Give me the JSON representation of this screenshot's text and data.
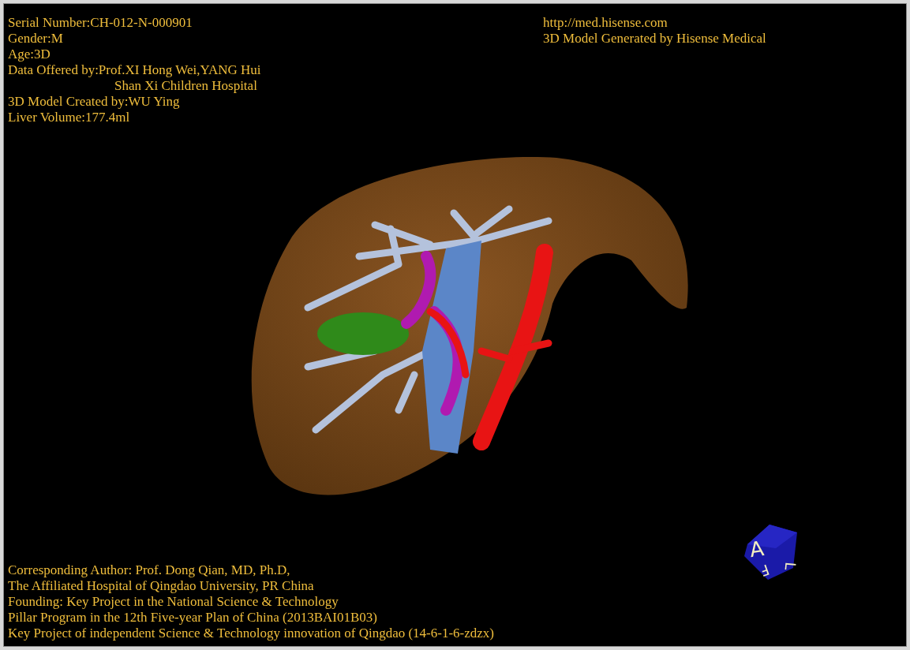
{
  "top_left_info": [
    {
      "text": "Serial Number:CH-012-N-000901",
      "kind": "line"
    },
    {
      "text": "Gender:M",
      "kind": "line"
    },
    {
      "text": "Age:3D",
      "kind": "line"
    },
    {
      "text": "Data Offered by:Prof.XI Hong Wei,YANG Hui",
      "kind": "line"
    },
    {
      "text": "Shan Xi Children Hospital",
      "kind": "continuation"
    },
    {
      "text": "3D Model Created by:WU Ying",
      "kind": "line"
    },
    {
      "text": "Liver Volume:177.4ml",
      "kind": "line"
    }
  ],
  "top_right_info": [
    "http://med.hisense.com",
    "3D Model Generated by Hisense Medical"
  ],
  "bottom_credits": [
    "Corresponding Author: Prof. Dong Qian, MD, Ph.D,",
    "The Affiliated Hospital of Qingdao University, PR China",
    "Founding: Key Project in the National Science & Technology",
    "Pillar Program in the 12th Five-year Plan of China (2013BAI01B03)",
    "Key Project of independent Science & Technology innovation of Qingdao (14-6-1-6-zdzx)"
  ],
  "orientation_cube": {
    "faces": [
      "A",
      "L",
      "F"
    ]
  }
}
